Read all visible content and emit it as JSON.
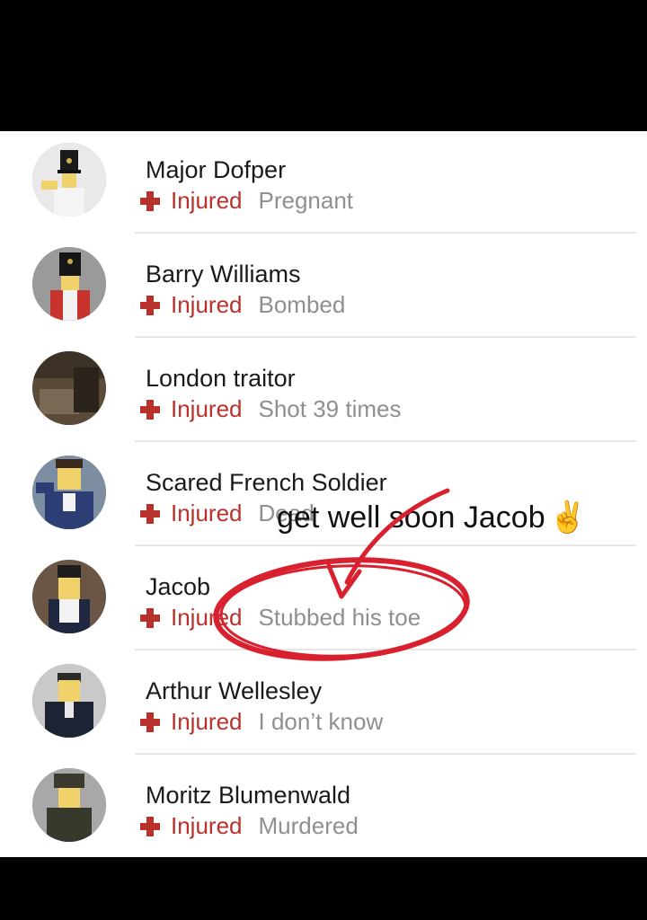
{
  "contacts": [
    {
      "name": "Major Dofper",
      "status": "Injured",
      "reason": "Pregnant",
      "avatar": "avatar-major-dofper"
    },
    {
      "name": "Barry Williams",
      "status": "Injured",
      "reason": "Bombed",
      "avatar": "avatar-barry-williams"
    },
    {
      "name": "London traitor",
      "status": "Injured",
      "reason": "Shot 39 times",
      "avatar": "avatar-london-traitor"
    },
    {
      "name": "Scared French Soldier",
      "status": "Injured",
      "reason": "Dead",
      "avatar": "avatar-scared-french-soldier"
    },
    {
      "name": "Jacob",
      "status": "Injured",
      "reason": "Stubbed his toe",
      "avatar": "avatar-jacob"
    },
    {
      "name": "Arthur Wellesley",
      "status": "Injured",
      "reason": "I don’t know",
      "avatar": "avatar-arthur-wellesley"
    },
    {
      "name": "Moritz Blumenwald",
      "status": "Injured",
      "reason": "Murdered",
      "avatar": "avatar-moritz-blumenwald"
    }
  ],
  "annotation": {
    "text": "get well soon Jacob",
    "emoji": "✌",
    "circle_color": "#d8202e",
    "arrow_color": "#d8202e"
  },
  "colors": {
    "status": "#b8322b",
    "reason": "#8f8f8f",
    "name": "#1a1a1a"
  }
}
